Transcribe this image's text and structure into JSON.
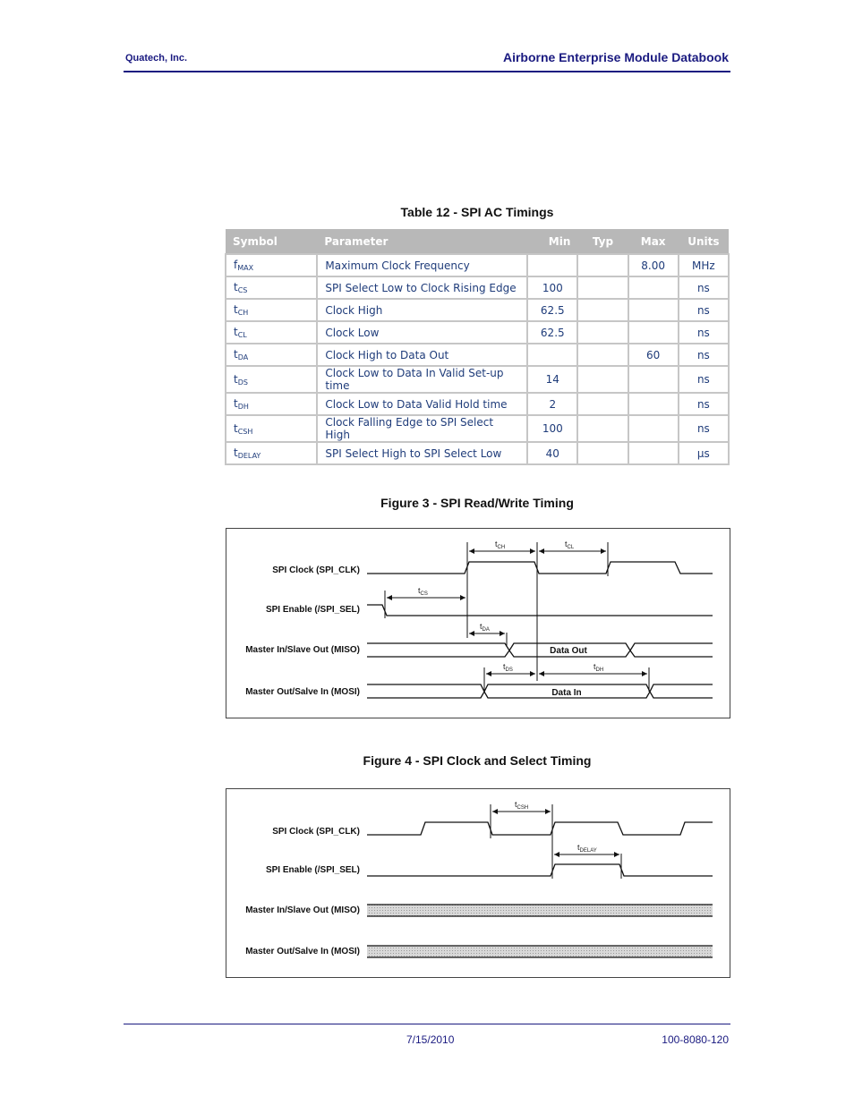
{
  "header": {
    "company": "Quatech, Inc.",
    "document_title": "Airborne Enterprise Module Databook"
  },
  "table": {
    "caption": "Table 12 - SPI AC Timings",
    "columns": [
      "Symbol",
      "Parameter",
      "Min",
      "Typ",
      "Max",
      "Units"
    ],
    "rows": [
      {
        "symbol": "f",
        "sub": "MAX",
        "parameter": "Maximum Clock Frequency",
        "min": "",
        "typ": "",
        "max": "8.00",
        "units": "MHz"
      },
      {
        "symbol": "t",
        "sub": "CS",
        "parameter": "SPI Select Low to Clock Rising Edge",
        "min": "100",
        "typ": "",
        "max": "",
        "units": "ns"
      },
      {
        "symbol": "t",
        "sub": "CH",
        "parameter": "Clock High",
        "min": "62.5",
        "typ": "",
        "max": "",
        "units": "ns"
      },
      {
        "symbol": "t",
        "sub": "CL",
        "parameter": "Clock Low",
        "min": "62.5",
        "typ": "",
        "max": "",
        "units": "ns"
      },
      {
        "symbol": "t",
        "sub": "DA",
        "parameter": "Clock High to Data Out",
        "min": "",
        "typ": "",
        "max": "60",
        "units": "ns"
      },
      {
        "symbol": "t",
        "sub": "DS",
        "parameter": "Clock Low to Data In Valid Set-up time",
        "min": "14",
        "typ": "",
        "max": "",
        "units": "ns"
      },
      {
        "symbol": "t",
        "sub": "DH",
        "parameter": "Clock Low to Data Valid Hold time",
        "min": "2",
        "typ": "",
        "max": "",
        "units": "ns"
      },
      {
        "symbol": "t",
        "sub": "CSH",
        "parameter": "Clock Falling Edge to SPI Select High",
        "min": "100",
        "typ": "",
        "max": "",
        "units": "ns"
      },
      {
        "symbol": "t",
        "sub": "DELAY",
        "parameter": "SPI Select High to SPI Select Low",
        "min": "40",
        "typ": "",
        "max": "",
        "units": "µs"
      }
    ]
  },
  "figure3": {
    "caption": "Figure 3 - SPI Read/Write Timing",
    "signals": [
      "SPI Clock (SPI_CLK)",
      "SPI Enable (/SPI_SEL)",
      "Master In/Slave Out (MISO)",
      "Master Out/Salve In (MOSI)"
    ],
    "miso_label": "Data Out",
    "mosi_label": "Data In",
    "timing_labels": {
      "tch": "CH",
      "tcl": "CL",
      "tcs": "CS",
      "tda": "DA",
      "tds": "DS",
      "tdh": "DH"
    }
  },
  "figure4": {
    "caption": "Figure 4 - SPI Clock and Select Timing",
    "signals": [
      "SPI Clock (SPI_CLK)",
      "SPI Enable (/SPI_SEL)",
      "Master In/Slave Out (MISO)",
      "Master Out/Salve In (MOSI)"
    ],
    "timing_labels": {
      "tcsh": "CSH",
      "tdelay": "DELAY"
    }
  },
  "footer": {
    "date": "7/15/2010",
    "doc_number": "100-8080-120"
  }
}
